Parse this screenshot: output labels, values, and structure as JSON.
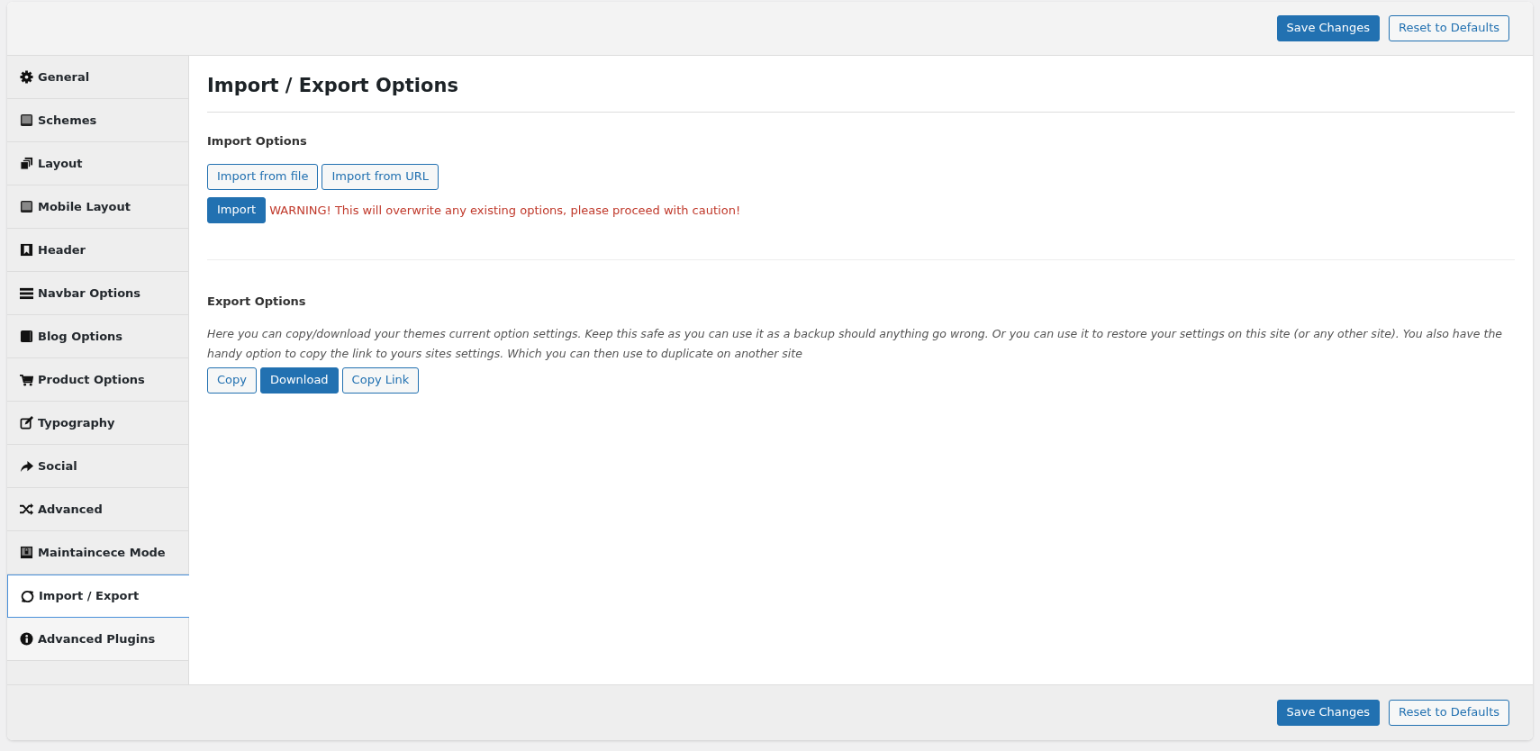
{
  "header_buttons": [
    {
      "label": "Save Changes",
      "kind": "primary"
    },
    {
      "label": "Reset to Defaults",
      "kind": "outline"
    }
  ],
  "sidebar": {
    "items": [
      {
        "label": "General",
        "selected": false
      },
      {
        "label": "Schemes",
        "selected": false
      },
      {
        "label": "Layout",
        "selected": false
      },
      {
        "label": "Mobile Layout",
        "selected": false
      },
      {
        "label": "Header",
        "selected": false
      },
      {
        "label": "Navbar Options",
        "selected": false
      },
      {
        "label": "Blog Options",
        "selected": false
      },
      {
        "label": "Product Options",
        "selected": false
      },
      {
        "label": "Typography",
        "selected": false
      },
      {
        "label": "Social",
        "selected": false
      },
      {
        "label": "Advanced",
        "selected": false
      },
      {
        "label": "Maintaincece Mode",
        "selected": false
      },
      {
        "label": "Import / Export",
        "selected": true
      },
      {
        "label": "Advanced Plugins",
        "selected": false
      }
    ]
  },
  "page_title": "Import / Export Options",
  "import_section": {
    "heading": "Import Options",
    "buttons": [
      {
        "label": "Import from file",
        "kind": "outline"
      },
      {
        "label": "Import from URL",
        "kind": "outline"
      }
    ],
    "import_button": {
      "label": "Import",
      "kind": "primary"
    },
    "warning": "WARNING! This will overwrite any existing options, please proceed with caution!"
  },
  "export_section": {
    "heading": "Export Options",
    "description": "Here you can copy/download your themes current option settings. Keep this safe as you can use it as a backup should anything go wrong. Or you can use it to restore your settings on this site (or any other site). You also have the handy option to copy the link to yours sites settings. Which you can then use to duplicate on another site",
    "buttons": [
      {
        "label": "Copy",
        "kind": "outline"
      },
      {
        "label": "Download",
        "kind": "primary"
      },
      {
        "label": "Copy Link",
        "kind": "outline"
      }
    ]
  },
  "footer_buttons": [
    {
      "label": "Save Changes",
      "kind": "primary"
    },
    {
      "label": "Reset to Defaults",
      "kind": "outline"
    }
  ]
}
